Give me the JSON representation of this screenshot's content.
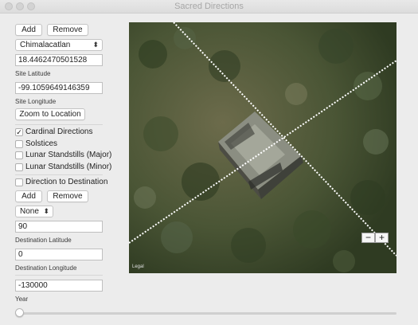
{
  "window": {
    "title": "Sacred Directions"
  },
  "site": {
    "add_label": "Add",
    "remove_label": "Remove",
    "selected_site": "Chimalacatlan",
    "latitude_value": "18.4462470501528",
    "latitude_caption": "Site Latitude",
    "longitude_value": "-99.1059649146359",
    "longitude_caption": "Site Longitude",
    "zoom_label": "Zoom to Location"
  },
  "options": {
    "cardinal": {
      "label": "Cardinal Directions",
      "checked": true
    },
    "solstices": {
      "label": "Solstices",
      "checked": false
    },
    "lunar_major": {
      "label": "Lunar Standstills (Major)",
      "checked": false
    },
    "lunar_minor": {
      "label": "Lunar Standstills (Minor)",
      "checked": false
    },
    "direction_to_destination": {
      "label": "Direction to Destination",
      "checked": false
    }
  },
  "destination": {
    "add_label": "Add",
    "remove_label": "Remove",
    "selected": "None",
    "latitude_value": "90",
    "latitude_caption": "Destination Latitude",
    "longitude_value": "0",
    "longitude_caption": "Destination Longitude"
  },
  "year": {
    "value": "-130000",
    "caption": "Year",
    "slider_fraction": 0.0
  },
  "map": {
    "legal_label": "Legal",
    "zoom_out": "−",
    "zoom_in": "+"
  },
  "icons": {
    "checkmark": "checkmark-icon",
    "chevron": "up-down-chevron-icon"
  }
}
